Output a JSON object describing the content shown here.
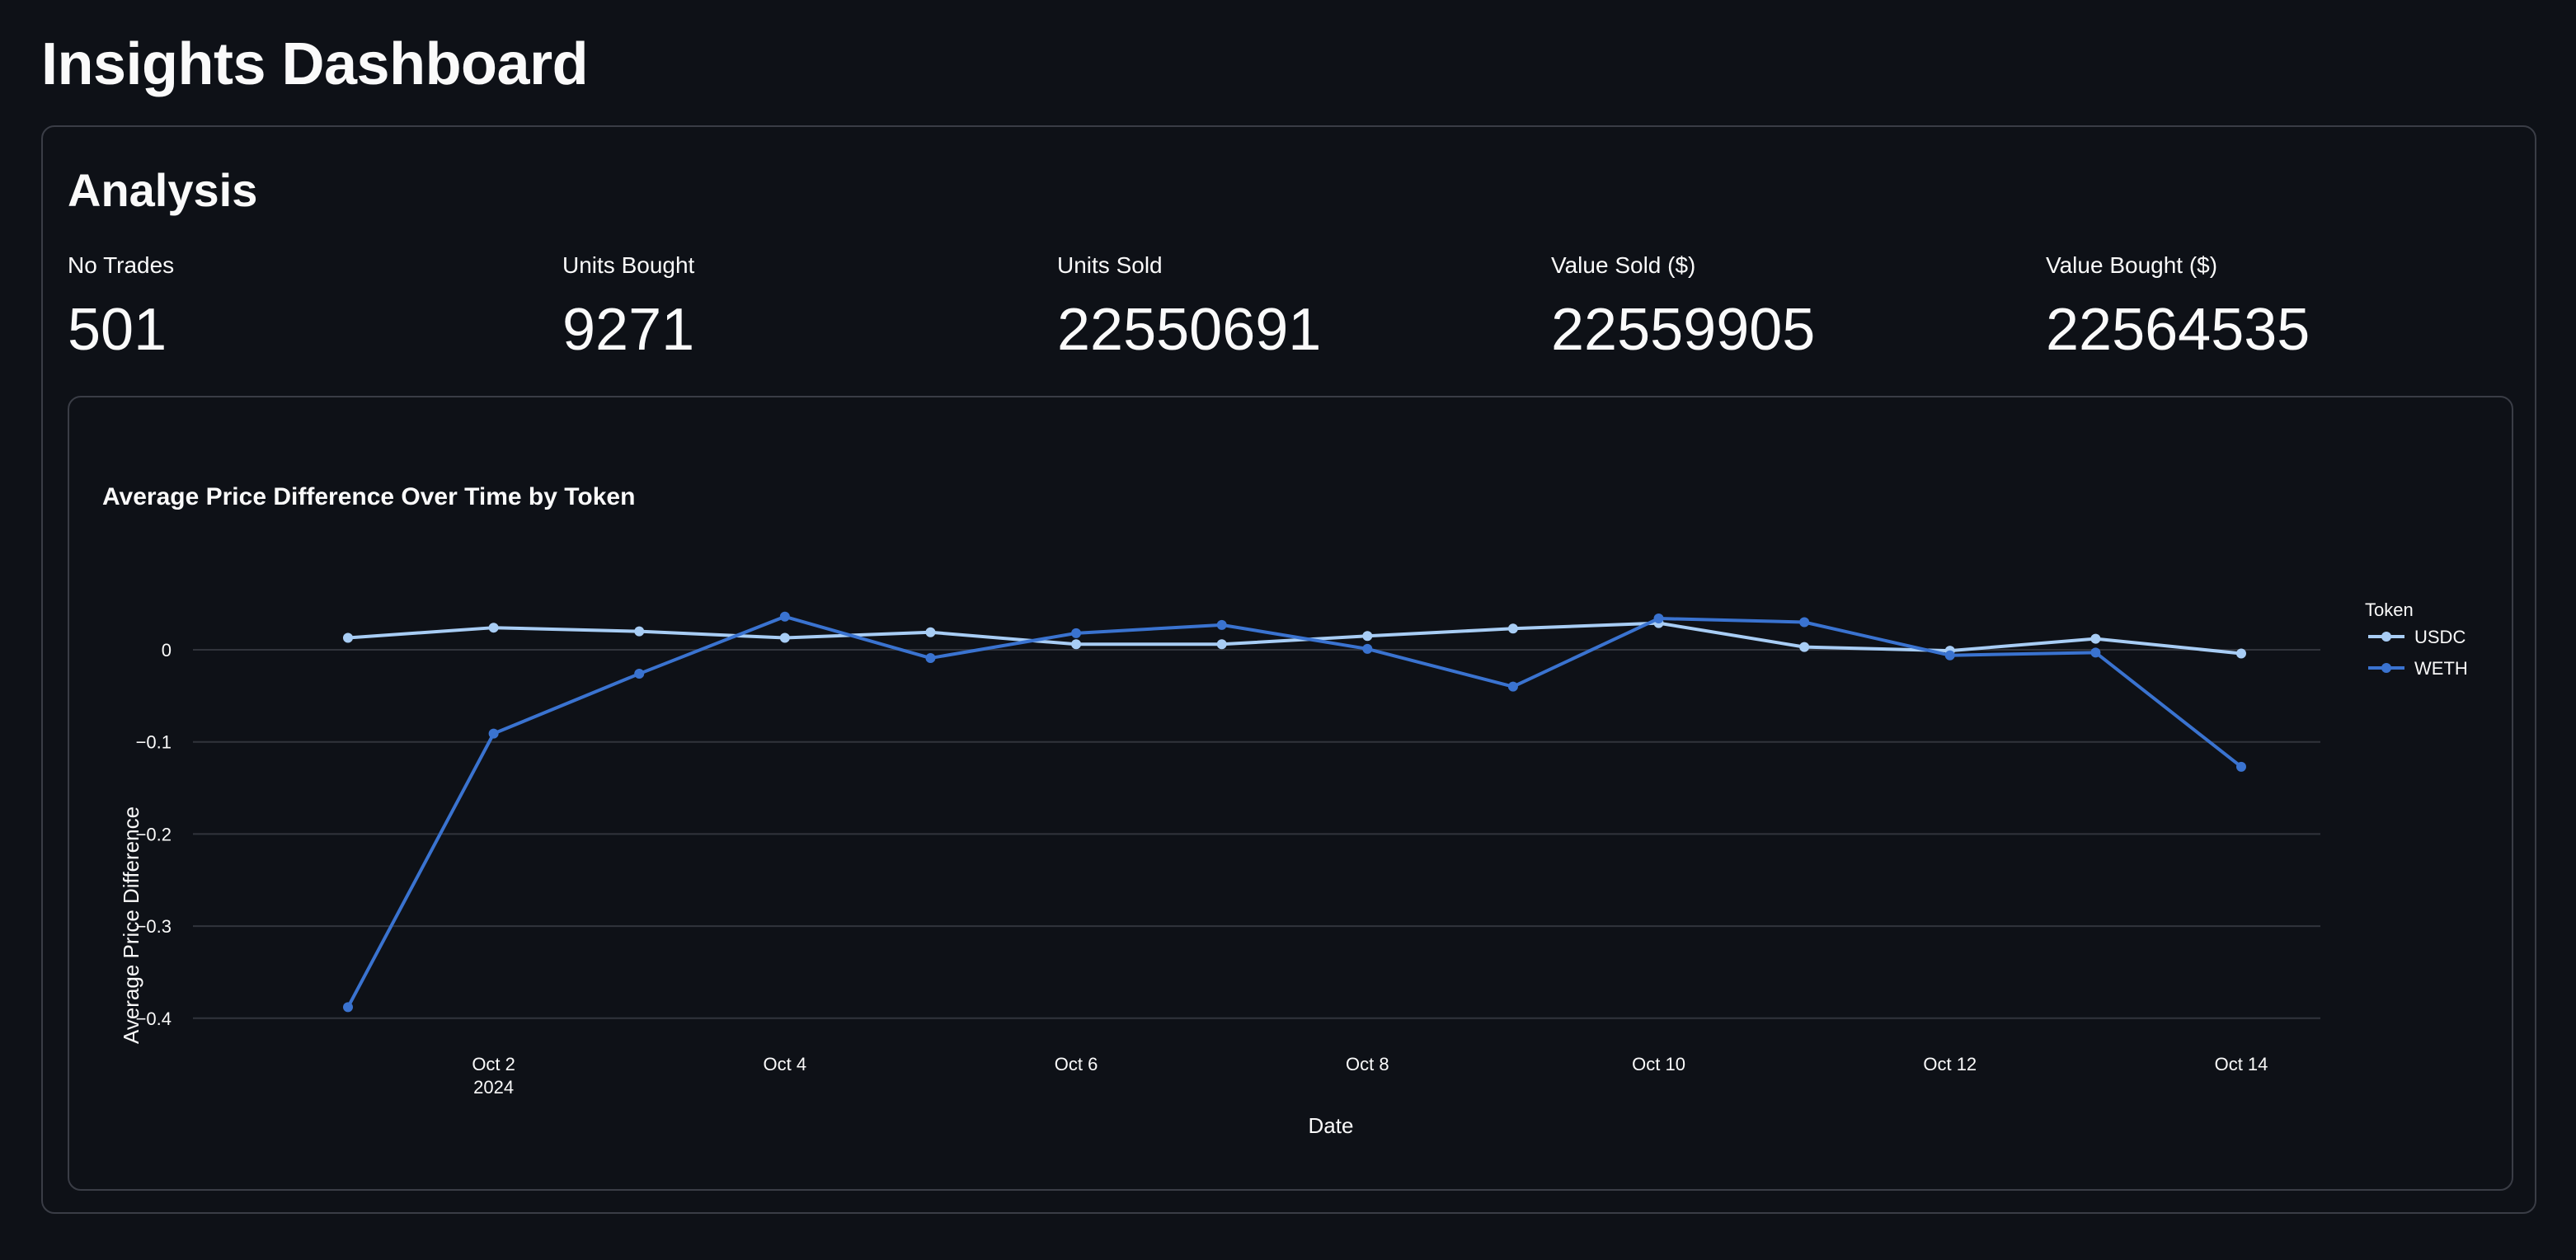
{
  "page_title": "Insights Dashboard",
  "section_title": "Analysis",
  "metrics": [
    {
      "label": "No Trades",
      "value": "501"
    },
    {
      "label": "Units Bought",
      "value": "9271"
    },
    {
      "label": "Units Sold",
      "value": "22550691"
    },
    {
      "label": "Value Sold ($)",
      "value": "22559905"
    },
    {
      "label": "Value Bought ($)",
      "value": "22564535"
    }
  ],
  "colors": {
    "background": "#0e1117",
    "border": "#3a3d46",
    "usdc": "#a8cdf5",
    "weth": "#3a73d0",
    "grid": "#31343c"
  },
  "chart_data": {
    "type": "line",
    "title": "Average Price Difference Over Time by Token",
    "xlabel": "Date",
    "ylabel": "Average Price Difference",
    "x": [
      "2024-10-01",
      "2024-10-02",
      "2024-10-03",
      "2024-10-04",
      "2024-10-05",
      "2024-10-06",
      "2024-10-07",
      "2024-10-08",
      "2024-10-09",
      "2024-10-10",
      "2024-10-11",
      "2024-10-12",
      "2024-10-13",
      "2024-10-14"
    ],
    "x_ticks": [
      {
        "date": "2024-10-02",
        "label": "Oct 2",
        "sublabel": "2024"
      },
      {
        "date": "2024-10-04",
        "label": "Oct 4"
      },
      {
        "date": "2024-10-06",
        "label": "Oct 6"
      },
      {
        "date": "2024-10-08",
        "label": "Oct 8"
      },
      {
        "date": "2024-10-10",
        "label": "Oct 10"
      },
      {
        "date": "2024-10-12",
        "label": "Oct 12"
      },
      {
        "date": "2024-10-14",
        "label": "Oct 14"
      }
    ],
    "y_ticks": [
      {
        "value": 0,
        "label": "0"
      },
      {
        "value": -0.1,
        "label": "−0.1"
      },
      {
        "value": -0.2,
        "label": "−0.2"
      },
      {
        "value": -0.3,
        "label": "−0.3"
      },
      {
        "value": -0.4,
        "label": "−0.4"
      }
    ],
    "ylim": [
      -0.4,
      0.05
    ],
    "grid": true,
    "legend": {
      "title": "Token",
      "placement": "top-right"
    },
    "series": [
      {
        "name": "USDC",
        "color": "#a8cdf5",
        "values": [
          0.013,
          0.024,
          0.02,
          0.013,
          0.019,
          0.006,
          0.006,
          0.015,
          0.023,
          0.029,
          0.003,
          -0.001,
          0.012,
          -0.004
        ]
      },
      {
        "name": "WETH",
        "color": "#3a73d0",
        "values": [
          -0.388,
          -0.091,
          -0.026,
          0.036,
          -0.009,
          0.018,
          0.027,
          0.001,
          -0.04,
          0.034,
          0.03,
          -0.006,
          -0.003,
          -0.127
        ]
      }
    ]
  }
}
